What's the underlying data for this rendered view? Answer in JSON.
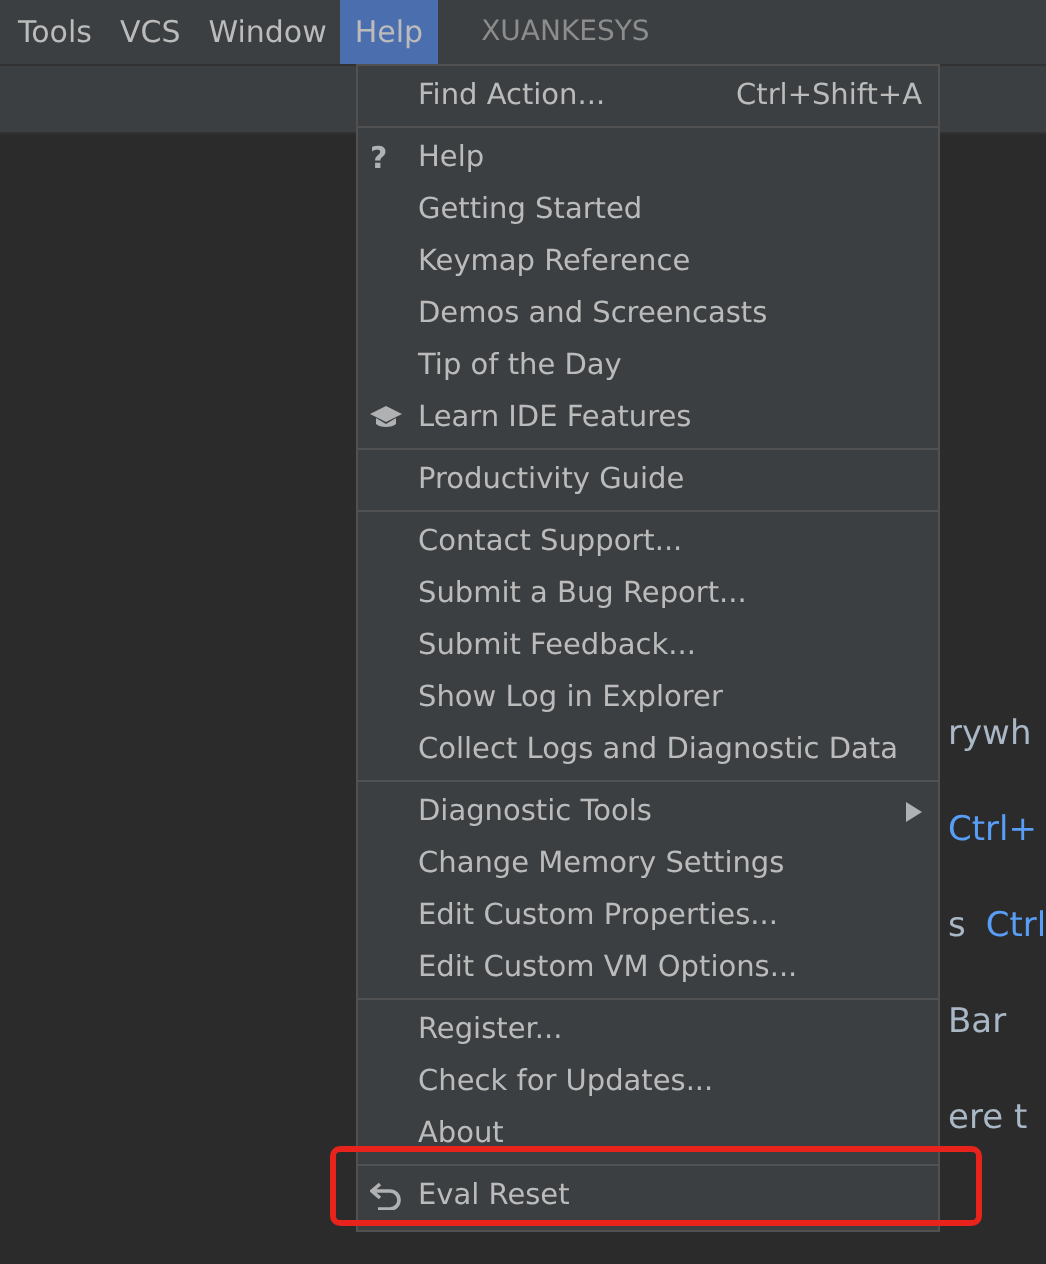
{
  "menu_bar": {
    "items": [
      {
        "label": "Tools",
        "selected": false
      },
      {
        "label": "VCS",
        "selected": false
      },
      {
        "label": "Window",
        "selected": false
      },
      {
        "label": "Help",
        "selected": true
      }
    ],
    "project": "XUANKESYS"
  },
  "help_menu": {
    "groups": [
      [
        {
          "label": "Find Action...",
          "shortcut": "Ctrl+Shift+A",
          "kind": "plain"
        }
      ],
      [
        {
          "label": "Help",
          "kind": "glyph",
          "glyph": "?"
        },
        {
          "label": "Getting Started",
          "kind": "plain"
        },
        {
          "label": "Keymap Reference",
          "kind": "plain"
        },
        {
          "label": "Demos and Screencasts",
          "kind": "plain"
        },
        {
          "label": "Tip of the Day",
          "kind": "plain"
        },
        {
          "label": "Learn IDE Features",
          "kind": "cap"
        }
      ],
      [
        {
          "label": "Productivity Guide",
          "kind": "plain"
        }
      ],
      [
        {
          "label": "Contact Support...",
          "kind": "plain"
        },
        {
          "label": "Submit a Bug Report...",
          "kind": "plain"
        },
        {
          "label": "Submit Feedback...",
          "kind": "plain"
        },
        {
          "label": "Show Log in Explorer",
          "kind": "plain"
        },
        {
          "label": "Collect Logs and Diagnostic Data",
          "kind": "plain"
        }
      ],
      [
        {
          "label": "Diagnostic Tools",
          "kind": "plain",
          "submenu": true
        },
        {
          "label": "Change Memory Settings",
          "kind": "plain"
        },
        {
          "label": "Edit Custom Properties...",
          "kind": "plain"
        },
        {
          "label": "Edit Custom VM Options...",
          "kind": "plain"
        }
      ],
      [
        {
          "label": "Register...",
          "kind": "plain"
        },
        {
          "label": "Check for Updates...",
          "kind": "plain"
        },
        {
          "label": "About",
          "kind": "plain"
        }
      ],
      [
        {
          "label": "Eval Reset",
          "kind": "undo",
          "highlighted": true
        }
      ]
    ]
  },
  "editor_hints": [
    {
      "parts": [
        {
          "text": "rywh",
          "kind": "plain"
        }
      ]
    },
    {
      "parts": [
        {
          "text": "Ctrl+",
          "kind": "key"
        }
      ]
    },
    {
      "parts": [
        {
          "text": "s",
          "kind": "plain"
        },
        {
          "text": "Ctrl",
          "kind": "key"
        }
      ]
    },
    {
      "parts": [
        {
          "text": "Bar",
          "kind": "plain"
        }
      ]
    },
    {
      "parts": [
        {
          "text": "ere t",
          "kind": "plain"
        }
      ]
    }
  ]
}
